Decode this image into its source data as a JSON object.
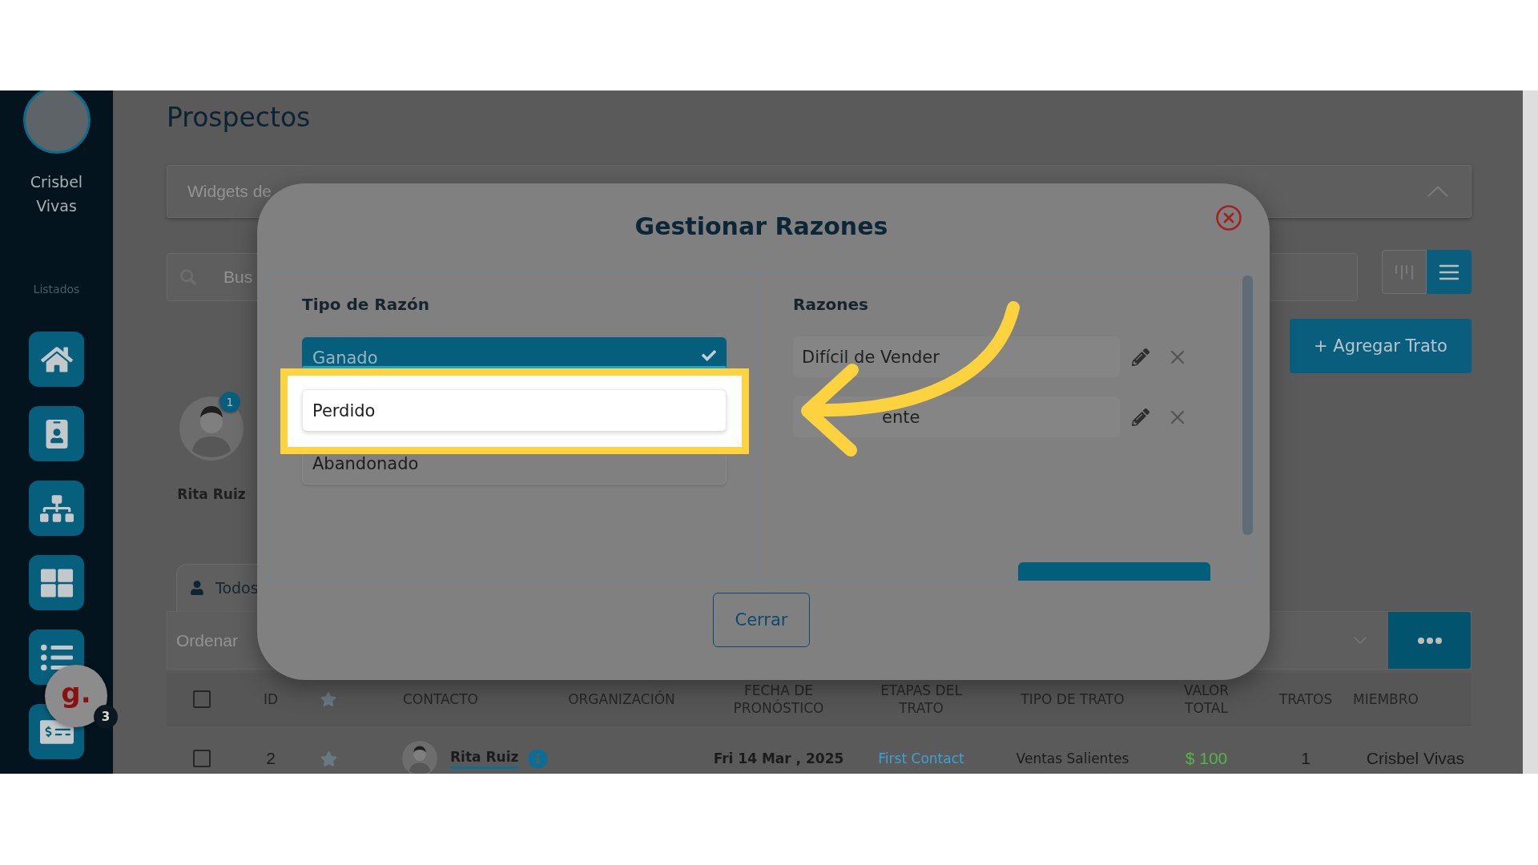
{
  "sidebar": {
    "user_name": "Crisbel Vivas",
    "section_label": "Listados"
  },
  "chat_widget": {
    "logo": "g.",
    "badge": "3"
  },
  "page_title": "Prospectos",
  "widgets_bar": {
    "label": "Widgets de",
    "expanded": true
  },
  "search": {
    "placeholder": "Bus"
  },
  "view_toggle": [
    {
      "kind": "board",
      "selected": false
    },
    {
      "kind": "list",
      "selected": true
    }
  ],
  "add_button": "+ Agregar Trato",
  "members": [
    {
      "name": "Rita Ruiz",
      "badge": "1"
    }
  ],
  "tabs": [
    {
      "label": "Todos",
      "selected": true
    }
  ],
  "sort": {
    "placeholder": "Ordenar"
  },
  "table": {
    "columns": [
      {
        "kind": "checkbox",
        "checked": false
      },
      {
        "kind": "text",
        "label": "ID"
      },
      {
        "kind": "star"
      },
      {
        "kind": "text",
        "label": "CONTACTO"
      },
      {
        "kind": "text",
        "label": "ORGANIZACIÓN"
      },
      {
        "kind": "text",
        "label": "FECHA DE\nPRONÓSTICO"
      },
      {
        "kind": "text",
        "label": "ETAPAS DEL\nTRATO"
      },
      {
        "kind": "text",
        "label": "TIPO DE TRATO"
      },
      {
        "kind": "text",
        "label": "VALOR\nTOTAL"
      },
      {
        "kind": "text",
        "label": "TRATOS"
      },
      {
        "kind": "text",
        "label": "MIEMBRO"
      }
    ],
    "rows": [
      {
        "checked": false,
        "id": "2",
        "starred": false,
        "contact": "Rita Ruiz",
        "forecast_date": "Fri 14 Mar , 2025",
        "stage": "First Contact",
        "deal_type": "Ventas Salientes",
        "total_value": "$ 100",
        "deals": "1",
        "member": "Crisbel Vivas"
      }
    ]
  },
  "modal": {
    "title": "Gestionar Razones",
    "types_heading": "Tipo de Razón",
    "types": [
      {
        "label": "Ganado",
        "selected": true,
        "highlighted": false
      },
      {
        "label": "Perdido",
        "selected": false,
        "highlighted": true
      },
      {
        "label": "Abandonado",
        "selected": false,
        "highlighted": false
      }
    ],
    "reasons_heading": "Razones",
    "reasons": [
      {
        "text": "Difícil de Vender",
        "obscured": false
      },
      {
        "text": "ente",
        "obscured": true
      }
    ],
    "close_button": "Cerrar"
  }
}
